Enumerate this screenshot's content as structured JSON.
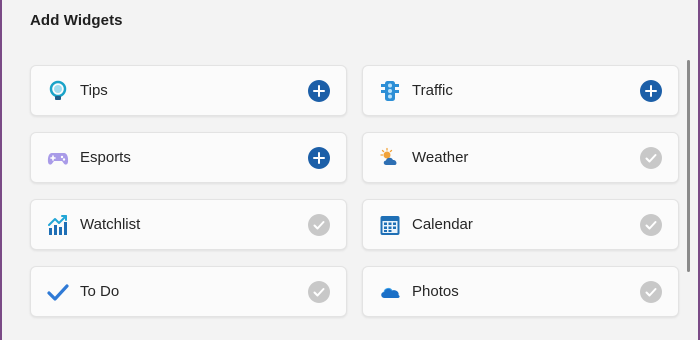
{
  "dialog": {
    "title": "Add Widgets"
  },
  "widgets": [
    {
      "label": "Tips",
      "icon": "lightbulb-icon",
      "state": "add"
    },
    {
      "label": "Traffic",
      "icon": "traffic-light-icon",
      "state": "add"
    },
    {
      "label": "Esports",
      "icon": "gamepad-icon",
      "state": "add"
    },
    {
      "label": "Weather",
      "icon": "weather-icon",
      "state": "added"
    },
    {
      "label": "Watchlist",
      "icon": "stock-chart-icon",
      "state": "added"
    },
    {
      "label": "Calendar",
      "icon": "calendar-icon",
      "state": "added"
    },
    {
      "label": "To Do",
      "icon": "checkmark-icon",
      "state": "added"
    },
    {
      "label": "Photos",
      "icon": "cloud-icon",
      "state": "added"
    }
  ],
  "colors": {
    "add_button": "#1c5fa8",
    "added_button": "#c8c8c8",
    "window_border": "#7a4a86"
  }
}
